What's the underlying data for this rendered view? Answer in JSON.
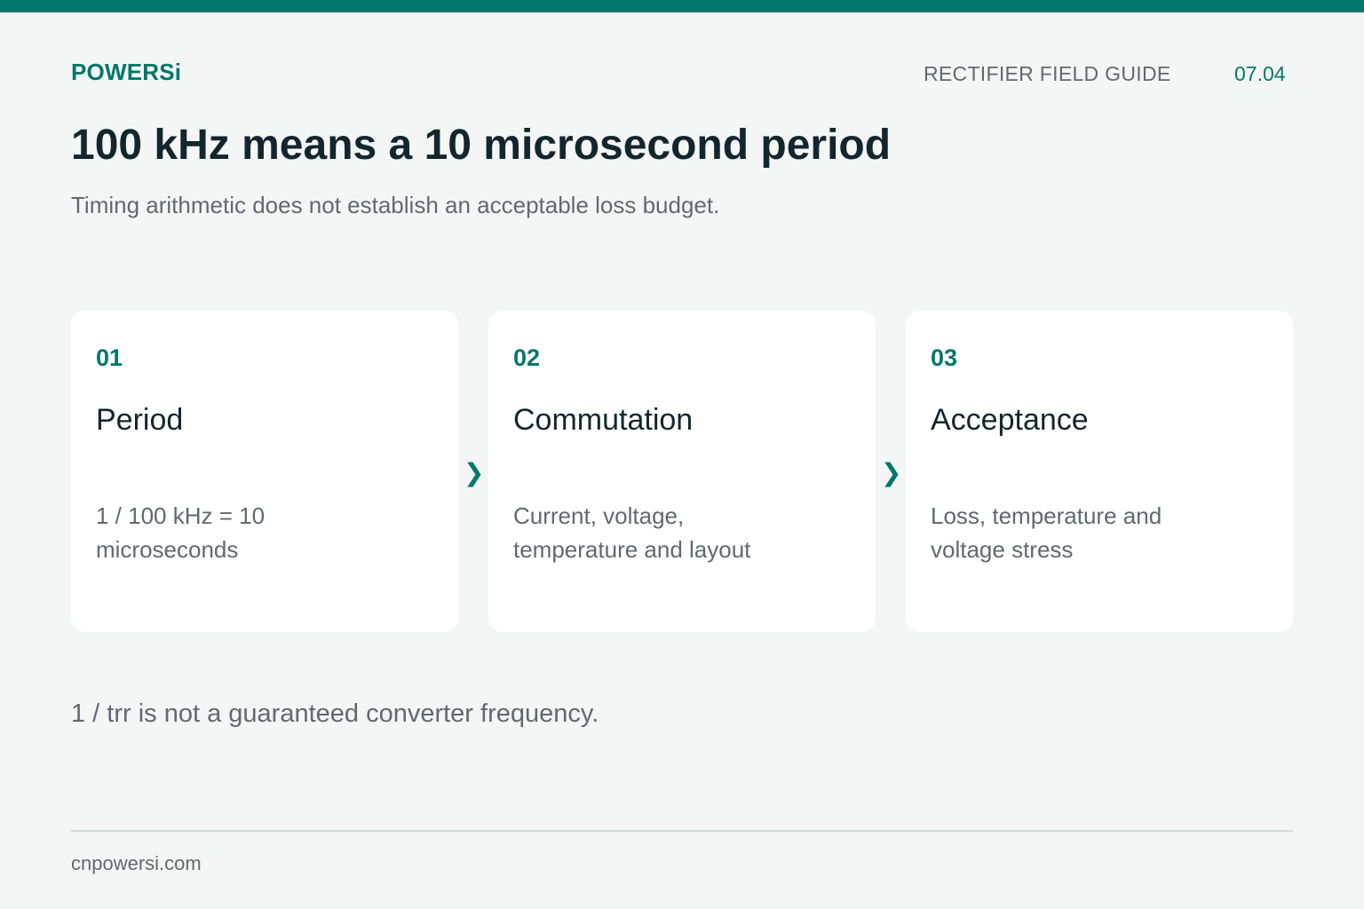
{
  "header": {
    "brand": "POWERSi",
    "guide_label": "RECTIFIER FIELD GUIDE",
    "page_number": "07.04"
  },
  "main": {
    "title": "100 kHz means a 10 microsecond period",
    "subtitle": "Timing arithmetic does not establish an acceptable loss budget.",
    "cards": [
      {
        "number": "01",
        "title": "Period",
        "body": "1 / 100 kHz = 10 microseconds"
      },
      {
        "number": "02",
        "title": "Commutation",
        "body": "Current, voltage, temperature and layout"
      },
      {
        "number": "03",
        "title": "Acceptance",
        "body": "Loss, temperature and voltage stress"
      }
    ],
    "arrow_glyph": "❯",
    "note": "1 / trr is not a guaranteed converter frequency."
  },
  "footer": {
    "url": "cnpowersi.com"
  },
  "colors": {
    "accent": "#00786a",
    "background": "#f4f6f5",
    "heading": "#13262e",
    "muted": "#5e6a70"
  }
}
